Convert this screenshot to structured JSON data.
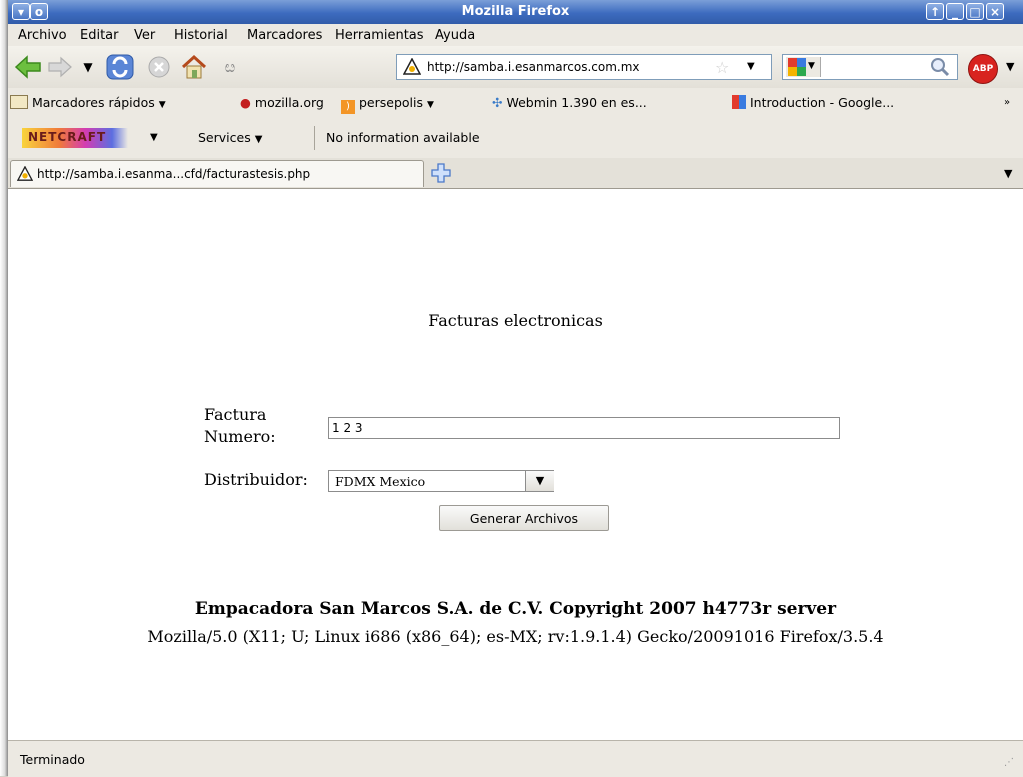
{
  "window": {
    "title": "Mozilla Firefox"
  },
  "menubar": {
    "items": [
      "Archivo",
      "Editar",
      "Ver",
      "Historial",
      "Marcadores",
      "Herramientas",
      "Ayuda"
    ]
  },
  "navbar": {
    "url": "http://samba.i.esanmarcos.com.mx",
    "search_placeholder": "",
    "icons": [
      "back-icon",
      "forward-icon",
      "history-dropdown-icon",
      "reload-icon",
      "stop-icon",
      "home-icon",
      "share-icon",
      "star-icon",
      "google-icon",
      "magnifier-icon",
      "adblock-icon"
    ],
    "adblock_label": "ABP"
  },
  "bookmarks": [
    "Marcadores rápidos",
    "mozilla.org",
    "persepolis",
    "Webmin 1.390 en es...",
    "Introduction - Google..."
  ],
  "bookmarks_overflow": "»",
  "netcraft": {
    "logo": "NETCRAFT",
    "services_label": "Services",
    "info": "No information available"
  },
  "tabs": [
    {
      "label": "http://samba.i.esanma...cfd/facturastesis.php"
    }
  ],
  "page": {
    "heading": "Facturas electronicas",
    "factura_label_line1": "Factura",
    "factura_label_line2": "Numero:",
    "factura_value": "1 2 3",
    "distribuidor_label": "Distribuidor:",
    "distribuidor_selected": "FDMX Mexico",
    "generate_button": "Generar Archivos",
    "footer_bold": "Empacadora San Marcos S.A. de C.V. Copyright 2007 h4773r server",
    "user_agent": "Mozilla/5.0 (X11; U; Linux i686 (x86_64); es-MX; rv:1.9.1.4) Gecko/20091016 Firefox/3.5.4"
  },
  "status": {
    "text": "Terminado"
  },
  "colors": {
    "titlebar": "#3d6bbf",
    "chrome": "#ece9e2",
    "link_blue": "#1f56b8"
  }
}
